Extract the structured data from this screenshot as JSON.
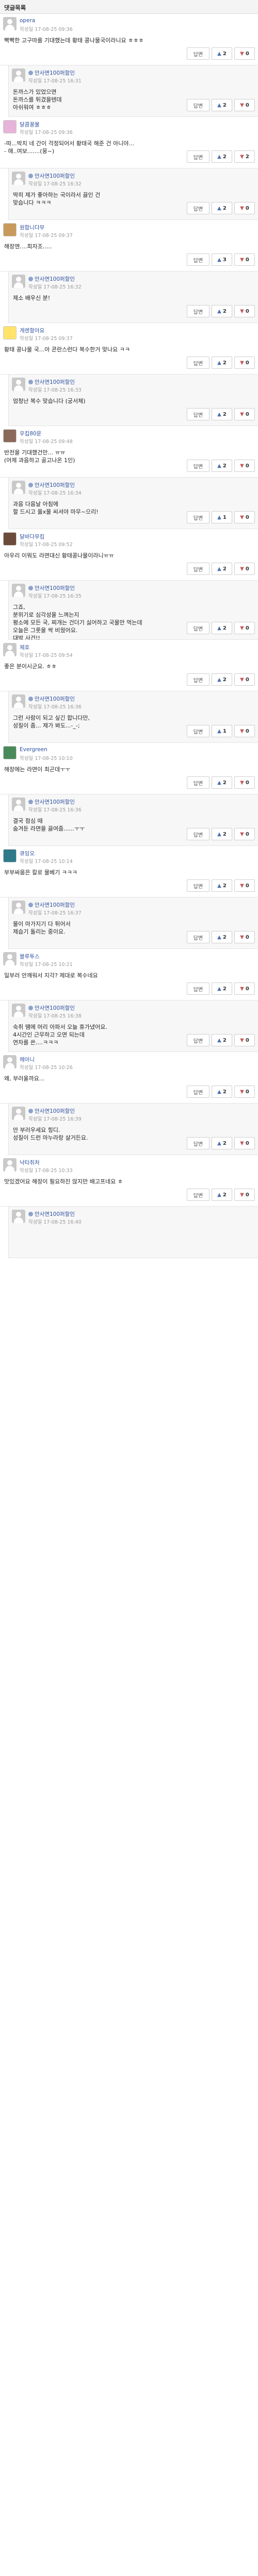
{
  "header": {
    "title": "댓글목록"
  },
  "ui": {
    "reply_label": "답변"
  },
  "icons": {
    "up": "thumbs-up-icon",
    "down": "thumbs-down-icon"
  },
  "comments": [
    {
      "nick": "opera",
      "date": "작성일 17-08-25 09:36",
      "body": "빡빡한 고구마를 기대했는데 황태 콩나물국이라니요 ㅎㅎㅎ",
      "up": "2",
      "down": "0"
    },
    {
      "nick": "안사면100퍼할인",
      "date": "작성일 17-08-25 16:31",
      "body": "돈까스가 있었으면\n돈까스를 튀겼을텐데\n아쉬워여 ㅎㅎㅎ",
      "up": "2",
      "down": "0"
    },
    {
      "nick": "달콤꿀물",
      "date": "작성일 17-08-25 09:36",
      "body": "-따...박치 네 간이 걱정되어서 황태국 해준 건 아니야...\n- 애..여보.......(뭉~)",
      "up": "2",
      "down": "2"
    },
    {
      "nick": "안사면100퍼할인",
      "date": "작성일 17-08-25 16:32",
      "body": "딱히 제가 좋아하는 국이라서 끓인 건\n맞습니다 ㅋㅋㅋ",
      "up": "2",
      "down": "0"
    },
    {
      "nick": "원합니다무",
      "date": "작성일 17-08-25 09:37",
      "body": "해장엔....최자조.....",
      "up": "3",
      "down": "0"
    },
    {
      "nick": "안사면100퍼할인",
      "date": "작성일 17-08-25 16:32",
      "body": "제소 배우신 분!",
      "up": "2",
      "down": "0"
    },
    {
      "nick": "게렌할아요",
      "date": "작성일 17-08-25 09:37",
      "body": "황태 콩나물 국...아 콘란스런다 복수한거 맞나요 ㅋㅋ",
      "up": "2",
      "down": "0"
    },
    {
      "nick": "안사면100퍼할인",
      "date": "작성일 17-08-25 16:33",
      "body": "엄청난 복수 맞습니다 (궁서체)",
      "up": "2",
      "down": "0"
    },
    {
      "nick": "우킵80운",
      "date": "작성일 17-08-25 09:48",
      "body": "반전을 기대했건만... ㅠㅠ\n(어제 과음하고 골고나온 1인)",
      "up": "2",
      "down": "0"
    },
    {
      "nick": "안사면100퍼할인",
      "date": "작성일 17-08-25 16:34",
      "body": "과음 다음날 아침에\n할 드시고 옳x물 씨셔야 마무~으리!",
      "up": "1",
      "down": "0"
    },
    {
      "nick": "달바다무킴",
      "date": "작성일 17-08-25 09:52",
      "body": "아우리 이뭐도 라면대신 황태콩나물이라니ㅠㅠ",
      "up": "2",
      "down": "0"
    },
    {
      "nick": "안사면100퍼할인",
      "date": "작성일 17-08-25 16:35",
      "body": "그죠,\n분위기로 심각성을 느껴는지\n평소에 모든 국, 찌개는 건더기 싫어하고 국물만 먹는데\n오늘은 그릇을 싹 비웠어요.\n대박 사건!!",
      "up": "2",
      "down": "0"
    },
    {
      "nick": "제호",
      "date": "작성일 17-08-25 09:54",
      "body": "좋은 분이시군요. ㅎㅎ",
      "up": "2",
      "down": "0"
    },
    {
      "nick": "안사면100퍼할인",
      "date": "작성일 17-08-25 16:36",
      "body": "그런 사람이 되고 싶긴 합니다만,\n성질이 좀... 제가 봐도...-_-;",
      "up": "1",
      "down": "0"
    },
    {
      "nick": "Evergreen",
      "date": "작성일 17-08-25 10:10",
      "body": "해장에는 라면이 최곤데ㅜㅜ",
      "up": "2",
      "down": "0"
    },
    {
      "nick": "안사면100퍼할인",
      "date": "작성일 17-08-25 16:36",
      "body": "결국 점심 때\n숨겨둔 라면을 끓여줌......ㅜㅜ",
      "up": "2",
      "down": "0"
    },
    {
      "nick": "큐잉오",
      "date": "작성일 17-08-25 10:14",
      "body": "부부싸움은 칼로 물베기 ㅋㅋㅋ",
      "up": "2",
      "down": "0"
    },
    {
      "nick": "안사면100퍼할인",
      "date": "작성일 17-08-25 16:37",
      "body": "물이 마가지기 다 튀어서\n제습기 돌리는 중이요.",
      "up": "2",
      "down": "0"
    },
    {
      "nick": "블루투스",
      "date": "작성일 17-08-25 10:21",
      "body": "일부러 안깨워서 지각? 제대로 복수네요",
      "up": "2",
      "down": "0"
    },
    {
      "nick": "안사면100퍼할인",
      "date": "작성일 17-08-25 16:38",
      "body": "숙취 땜에 머리 아파서 오늘 휴가냈어요.\n4시간인 근무하고 오면 되는데\n연차를 쓴....ㅋㅋㅋ",
      "up": "2",
      "down": "0"
    },
    {
      "nick": "헤아니",
      "date": "작성일 17-08-25 10:26",
      "body": "왜, 부러울까요...",
      "up": "2",
      "down": "0"
    },
    {
      "nick": "안사면100퍼할인",
      "date": "작성일 17-08-25 16:39",
      "body": "안 부러우세요 힝디.\n성질이 드런 마누라랑 살거든요.",
      "up": "2",
      "down": "0"
    },
    {
      "nick": "낙타취처",
      "date": "작성일 17-08-25 10:33",
      "body": "맛있겠어요 해장이 필요하진 않지만 배고프네요 ㅎ",
      "up": "2",
      "down": "0"
    },
    {
      "nick": "안사면100퍼할인",
      "date": "작성일 17-08-25 16:40",
      "body": "",
      "up": "",
      "down": ""
    }
  ]
}
